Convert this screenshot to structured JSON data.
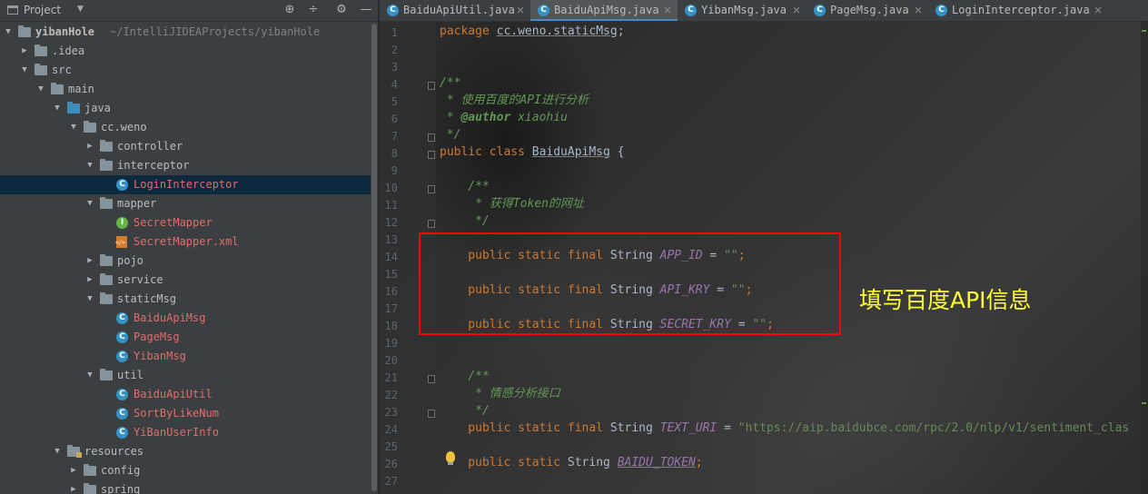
{
  "project_panel": {
    "title": "Project",
    "dropdown_glyph": "▼",
    "buttons": {
      "locate": "⊕",
      "collapse": "÷",
      "settings": "⚙",
      "hide": "—"
    },
    "tree": [
      {
        "label": "yibanHole",
        "path": "~/IntelliJIDEAProjects/yibanHole",
        "depth": 0,
        "expanded": true,
        "icon": "folder-icon",
        "bold": true
      },
      {
        "label": ".idea",
        "depth": 1,
        "expanded": false,
        "icon": "folder-icon"
      },
      {
        "label": "src",
        "depth": 1,
        "expanded": true,
        "icon": "folder-icon"
      },
      {
        "label": "main",
        "depth": 2,
        "expanded": true,
        "icon": "folder-icon"
      },
      {
        "label": "java",
        "depth": 3,
        "expanded": true,
        "icon": "source-folder-icon"
      },
      {
        "label": "cc.weno",
        "depth": 4,
        "expanded": true,
        "icon": "package-icon"
      },
      {
        "label": "controller",
        "depth": 5,
        "expanded": false,
        "icon": "package-icon"
      },
      {
        "label": "interceptor",
        "depth": 5,
        "expanded": true,
        "icon": "package-icon"
      },
      {
        "label": "LoginInterceptor",
        "depth": 6,
        "icon": "class-icon",
        "glyph": "C",
        "selected": true,
        "red": true
      },
      {
        "label": "mapper",
        "depth": 5,
        "expanded": true,
        "icon": "package-icon"
      },
      {
        "label": "SecretMapper",
        "depth": 6,
        "icon": "interface-icon",
        "glyph": "I",
        "red": true
      },
      {
        "label": "SecretMapper.xml",
        "depth": 6,
        "icon": "xml-file-icon",
        "red": true
      },
      {
        "label": "pojo",
        "depth": 5,
        "expanded": false,
        "icon": "package-icon"
      },
      {
        "label": "service",
        "depth": 5,
        "expanded": false,
        "icon": "package-icon"
      },
      {
        "label": "staticMsg",
        "depth": 5,
        "expanded": true,
        "icon": "package-icon"
      },
      {
        "label": "BaiduApiMsg",
        "depth": 6,
        "icon": "class-icon",
        "glyph": "C",
        "red": true
      },
      {
        "label": "PageMsg",
        "depth": 6,
        "icon": "class-icon",
        "glyph": "C",
        "red": true
      },
      {
        "label": "YibanMsg",
        "depth": 6,
        "icon": "class-icon",
        "glyph": "C",
        "red": true
      },
      {
        "label": "util",
        "depth": 5,
        "expanded": true,
        "icon": "package-icon"
      },
      {
        "label": "BaiduApiUtil",
        "depth": 6,
        "icon": "class-icon",
        "glyph": "C",
        "red": true
      },
      {
        "label": "SortByLikeNum",
        "depth": 6,
        "icon": "class-icon",
        "glyph": "C",
        "red": true
      },
      {
        "label": "YiBanUserInfo",
        "depth": 6,
        "icon": "class-icon",
        "glyph": "C",
        "red": true
      },
      {
        "label": "resources",
        "depth": 3,
        "expanded": true,
        "icon": "resources-folder-icon"
      },
      {
        "label": "config",
        "depth": 4,
        "expanded": false,
        "icon": "folder-icon"
      },
      {
        "label": "spring",
        "depth": 4,
        "expanded": false,
        "icon": "folder-icon"
      }
    ]
  },
  "editor": {
    "tabs": [
      {
        "label": "BaiduApiUtil.java",
        "active": false
      },
      {
        "label": "BaiduApiMsg.java",
        "active": true
      },
      {
        "label": "YibanMsg.java",
        "active": false
      },
      {
        "label": "PageMsg.java",
        "active": false
      },
      {
        "label": "LoginInterceptor.java",
        "active": false
      }
    ],
    "tab_close_glyph": "×",
    "line_numbers": [
      "1",
      "2",
      "3",
      "4",
      "5",
      "6",
      "7",
      "8",
      "9",
      "10",
      "11",
      "12",
      "13",
      "14",
      "15",
      "16",
      "17",
      "18",
      "19",
      "20",
      "21",
      "22",
      "23",
      "24",
      "25",
      "26",
      "27"
    ],
    "code": {
      "l1_kw": "package",
      "l1_pkg": "cc.weno.staticMsg",
      "l1_semi": ";",
      "l4": "/**",
      "l5": " * 使用百度的API进行分析",
      "l6_star": " * ",
      "l6_tag": "@author",
      "l6_name": " xiaohiu",
      "l7": " */",
      "l8_kw": "public class ",
      "l8_name": "BaiduApiMsg",
      "l8_rest": " {",
      "l10": "    /**",
      "l11": "     * 获得Token的网址",
      "l12": "     */",
      "l14_kw": "    public static final ",
      "l14_type": "String ",
      "l14_field": "APP_ID",
      "l14_eq": " = ",
      "l14_str": "\"\"",
      "l14_semi": ";",
      "l16_kw": "    public static final ",
      "l16_type": "String ",
      "l16_field": "API_KRY",
      "l16_eq": " = ",
      "l16_str": "\"\"",
      "l16_semi": ";",
      "l18_kw": "    public static final ",
      "l18_type": "String ",
      "l18_field": "SECRET_KRY",
      "l18_eq": " = ",
      "l18_str": "\"\"",
      "l18_semi": ";",
      "l21": "    /**",
      "l22": "     * 情感分析接口",
      "l23": "     */",
      "l24_kw": "    public static final ",
      "l24_type": "String ",
      "l24_field": "TEXT_URI",
      "l24_eq": " = ",
      "l24_str": "\"https://aip.baidubce.com/rpc/2.0/nlp/v1/sentiment_clas",
      "l26_kw": "    public static ",
      "l26_type": "String ",
      "l26_field": "BAIDU_TOKEN",
      "l26_semi": ";"
    },
    "annotation": "填写百度API信息"
  },
  "colors": {
    "keyword": "#cc7832",
    "comment": "#629755",
    "field": "#9876aa",
    "string": "#6a8759",
    "highlight_box": "#ff0000",
    "annotation": "#ffff33",
    "selected_row": "#0d293e"
  }
}
